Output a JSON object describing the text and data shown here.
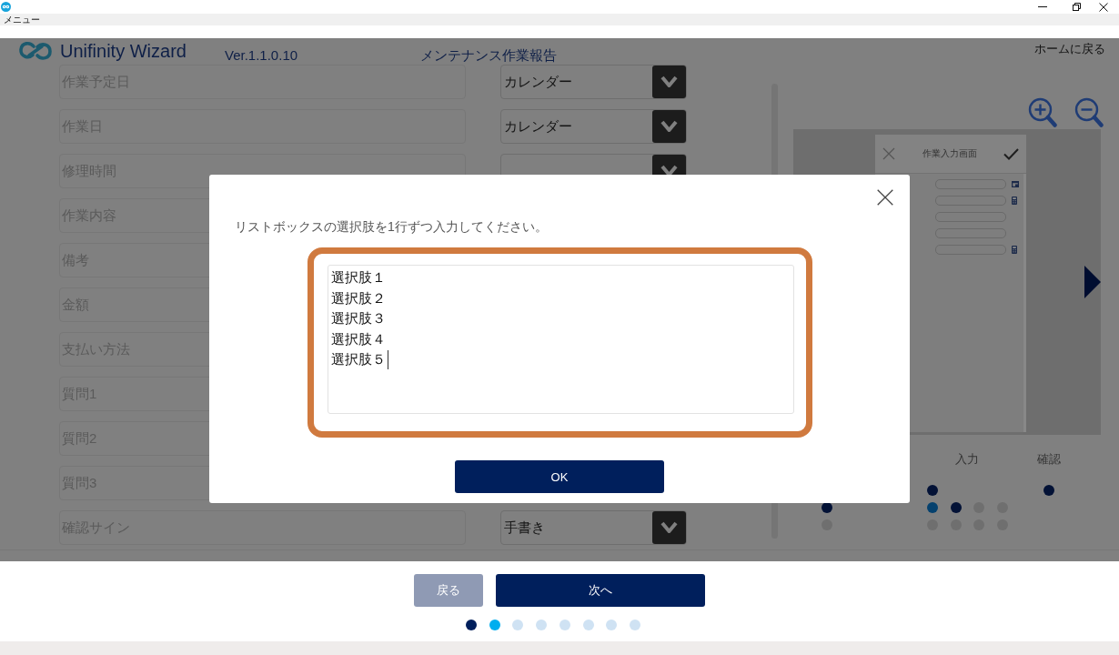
{
  "menu_bar": {
    "items": [
      "メニュー"
    ]
  },
  "header": {
    "app_name": "Unifinity Wizard",
    "version": "Ver.1.1.0.10",
    "screen_title": "メンテナンス作業報告",
    "home_link": "ホームに戻る"
  },
  "form": {
    "rows": [
      {
        "label": "作業予定日",
        "control": {
          "kind": "dropdown",
          "value": "カレンダー"
        }
      },
      {
        "label": "作業日",
        "control": {
          "kind": "dropdown",
          "value": "カレンダー"
        }
      },
      {
        "label": "修理時間",
        "control": {
          "kind": "dropdown"
        }
      },
      {
        "label": "作業内容"
      },
      {
        "label": "備考"
      },
      {
        "label": "金額"
      },
      {
        "label": "支払い方法"
      },
      {
        "label": "質問1"
      },
      {
        "label": "質問2"
      },
      {
        "label": "質問3"
      },
      {
        "label": "確認サイン",
        "control": {
          "kind": "dropdown",
          "value": "手書き"
        }
      }
    ]
  },
  "preview": {
    "title": "作業入力画面",
    "fields": [
      {
        "kind": "date"
      },
      {
        "kind": "number"
      },
      {
        "kind": "text"
      },
      {
        "kind": "text"
      },
      {
        "kind": "number"
      }
    ]
  },
  "page_map": {
    "stages": [
      {
        "rows": [
          {},
          {
            "dots": [
              {
                "color": "#031236"
              }
            ]
          },
          {
            "dots": [
              {
                "color": "#6f6f6f"
              }
            ]
          }
        ]
      },
      {
        "label": "入力",
        "rows": [
          {
            "dots": [
              {
                "color": "#031236"
              }
            ]
          },
          {
            "dots": [
              {
                "color": "#05416e"
              },
              {
                "color": "#031236"
              },
              {
                "color": "#6f6f6f"
              },
              {
                "color": "#6f6f6f"
              }
            ]
          },
          {
            "dots": [
              {
                "color": "#6f6f6f"
              },
              {
                "color": "#6f6f6f"
              },
              {
                "color": "#6f6f6f"
              },
              {
                "color": "#6f6f6f"
              }
            ]
          }
        ]
      },
      {
        "label": "確認",
        "rows": [
          {
            "dots": [
              {
                "color": "#031236"
              }
            ]
          }
        ]
      }
    ]
  },
  "dialog": {
    "message": "リストボックスの選択肢を1行ずつ入力してください。",
    "textarea": {
      "lines": [
        "選択肢１",
        "選択肢２",
        "選択肢３",
        "選択肢４",
        "選択肢５"
      ],
      "focused": true,
      "highlighted": true
    },
    "ok_button": "OK"
  },
  "footer": {
    "buttons": [
      {
        "label": "戻る",
        "disabled": true
      },
      {
        "label": "次へ",
        "disabled": false
      }
    ],
    "steps": [
      {
        "color": "#001f5c"
      },
      {
        "color": "#00aeef"
      },
      {
        "color": "#cfe2f3"
      },
      {
        "color": "#cfe2f3"
      },
      {
        "color": "#cfe2f3"
      },
      {
        "color": "#cfe2f3"
      },
      {
        "color": "#cfe2f3"
      },
      {
        "color": "#cfe2f3"
      }
    ]
  }
}
